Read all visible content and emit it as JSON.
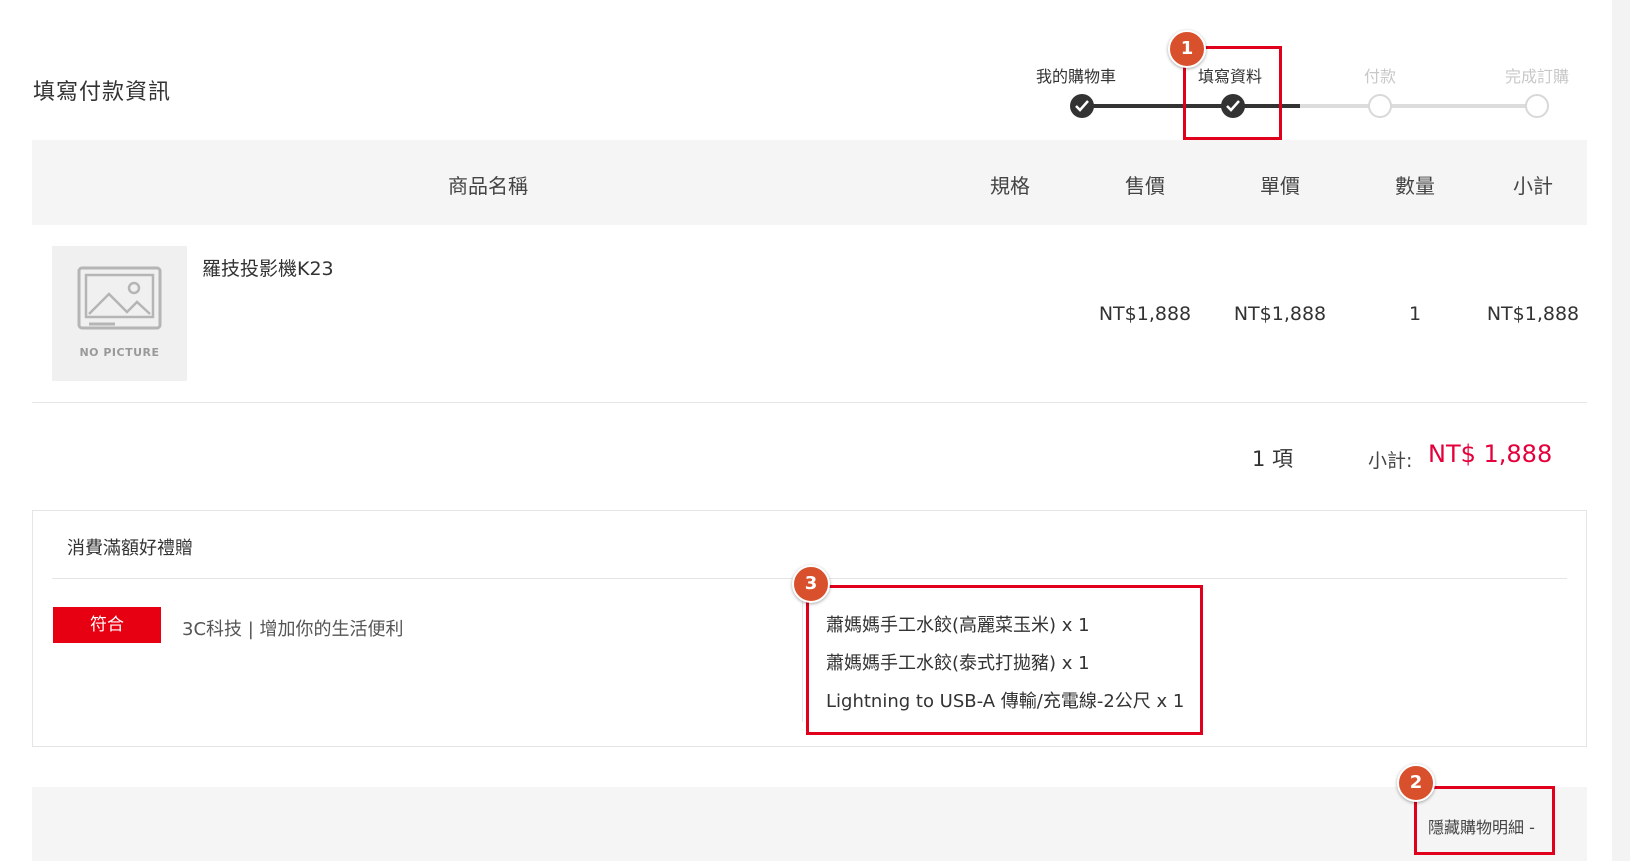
{
  "page": {
    "title": "填寫付款資訊"
  },
  "steps": [
    {
      "label": "我的購物車",
      "state": "done"
    },
    {
      "label": "填寫資料",
      "state": "done"
    },
    {
      "label": "付款",
      "state": "todo"
    },
    {
      "label": "完成訂購",
      "state": "todo"
    }
  ],
  "table": {
    "headers": [
      "商品名稱",
      "規格",
      "售價",
      "單價",
      "數量",
      "小計"
    ],
    "rows": [
      {
        "image_placeholder": "NO PICTURE",
        "name": "羅技投影機K23",
        "spec": "",
        "price": "NT$1,888",
        "unit_price": "NT$1,888",
        "quantity": "1",
        "subtotal": "NT$1,888"
      }
    ]
  },
  "summary": {
    "count": "1 項",
    "subtotal_label": "小計:",
    "subtotal_value": "NT$ 1,888"
  },
  "gift": {
    "title": "消費滿額好禮贈",
    "badge": "符合",
    "condition": "3C科技 | 增加你的生活便利",
    "items": [
      "蕭媽媽手工水餃(高麗菜玉米) x 1",
      "蕭媽媽手工水餃(泰式打拋豬) x 1",
      "Lightning to USB-A 傳輸/充電線-2公尺 x 1"
    ]
  },
  "footer": {
    "toggle_label": "隱藏購物明細 -"
  },
  "annotations": {
    "marker_1": "1",
    "marker_2": "2",
    "marker_3": "3"
  },
  "colors": {
    "accent_red": "#e4003a",
    "badge_red": "#e60012",
    "step_active": "#333333",
    "step_inactive": "#d8d8d8",
    "highlight": "#e0001b",
    "marker": "#d9512c"
  }
}
